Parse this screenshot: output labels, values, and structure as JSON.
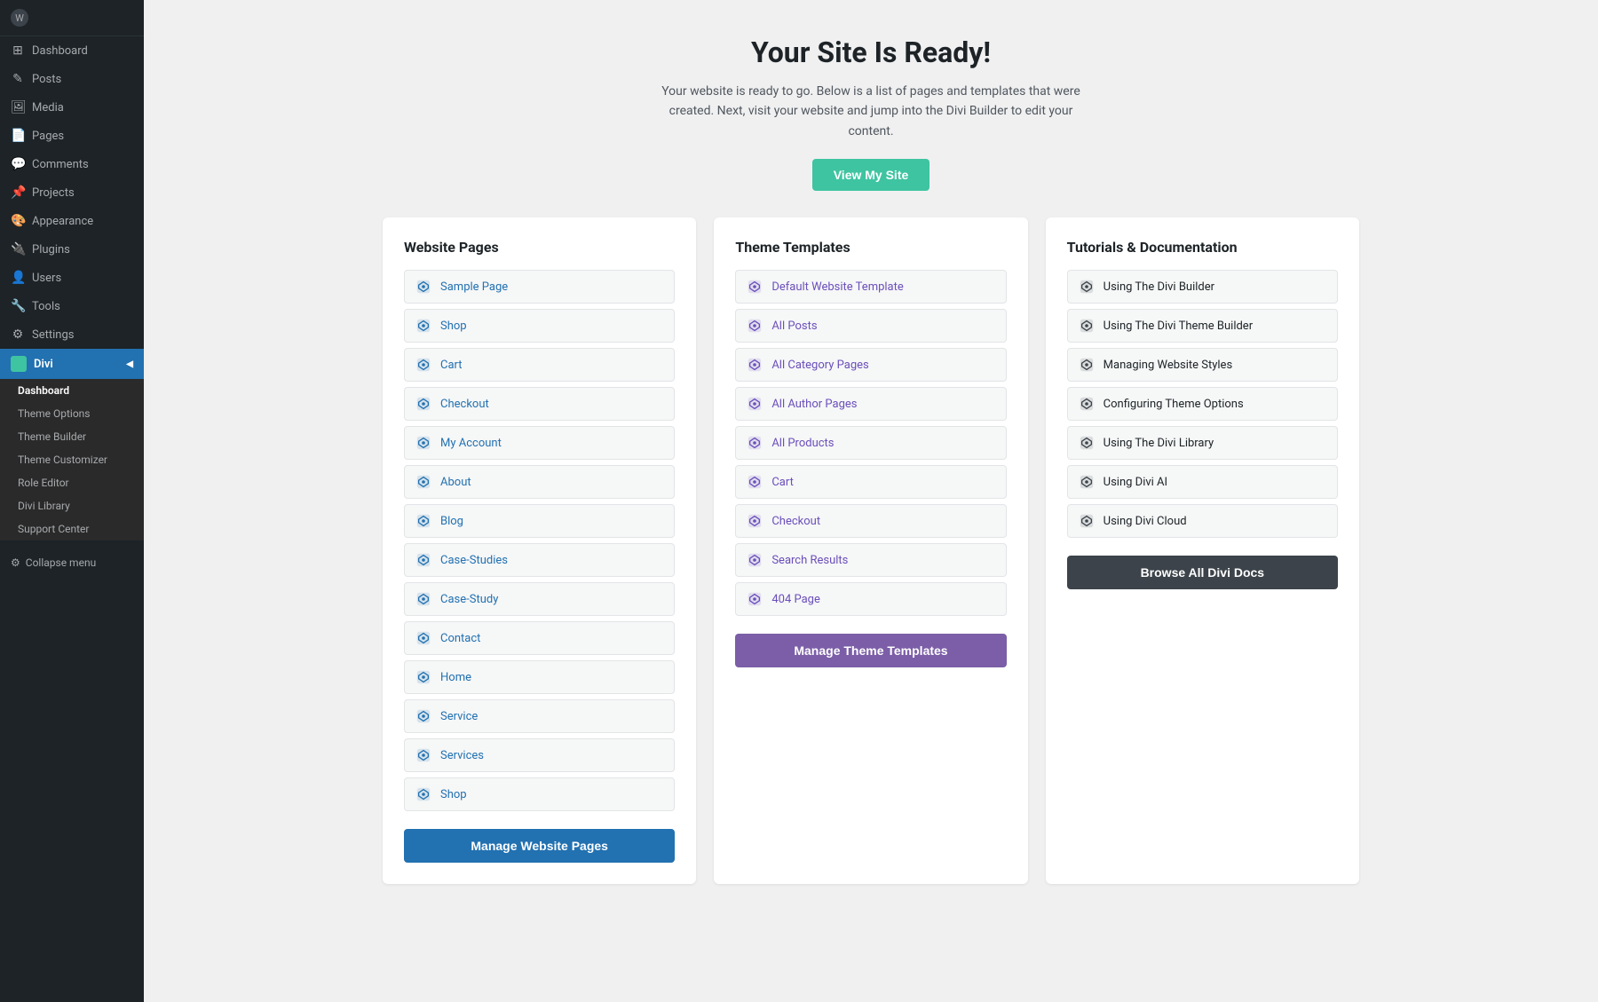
{
  "sidebar": {
    "items": [
      {
        "id": "dashboard",
        "label": "Dashboard",
        "icon": "⊞"
      },
      {
        "id": "posts",
        "label": "Posts",
        "icon": "✎"
      },
      {
        "id": "media",
        "label": "Media",
        "icon": "🖼"
      },
      {
        "id": "pages",
        "label": "Pages",
        "icon": "📄"
      },
      {
        "id": "comments",
        "label": "Comments",
        "icon": "💬"
      },
      {
        "id": "projects",
        "label": "Projects",
        "icon": "📌"
      },
      {
        "id": "appearance",
        "label": "Appearance",
        "icon": "🎨"
      },
      {
        "id": "plugins",
        "label": "Plugins",
        "icon": "🔌"
      },
      {
        "id": "users",
        "label": "Users",
        "icon": "👤"
      },
      {
        "id": "tools",
        "label": "Tools",
        "icon": "🔧"
      },
      {
        "id": "settings",
        "label": "Settings",
        "icon": "⚙"
      }
    ],
    "divi": {
      "label": "Divi",
      "subitems": [
        {
          "id": "dashboard",
          "label": "Dashboard",
          "active": true
        },
        {
          "id": "theme-options",
          "label": "Theme Options"
        },
        {
          "id": "theme-builder",
          "label": "Theme Builder"
        },
        {
          "id": "theme-customizer",
          "label": "Theme Customizer"
        },
        {
          "id": "role-editor",
          "label": "Role Editor"
        },
        {
          "id": "divi-library",
          "label": "Divi Library"
        },
        {
          "id": "support-center",
          "label": "Support Center"
        }
      ]
    },
    "collapse_label": "Collapse menu"
  },
  "main": {
    "title": "Your Site Is Ready!",
    "subtitle": "Your website is ready to go. Below is a list of pages and templates that were created. Next, visit your website and jump into the Divi Builder to edit your content.",
    "view_site_btn": "View My Site",
    "columns": {
      "website_pages": {
        "heading": "Website Pages",
        "items": [
          "Sample Page",
          "Shop",
          "Cart",
          "Checkout",
          "My Account",
          "About",
          "Blog",
          "Case-Studies",
          "Case-Study",
          "Contact",
          "Home",
          "Service",
          "Services",
          "Shop"
        ],
        "manage_btn": "Manage Website Pages"
      },
      "theme_templates": {
        "heading": "Theme Templates",
        "items": [
          "Default Website Template",
          "All Posts",
          "All Category Pages",
          "All Author Pages",
          "All Products",
          "Cart",
          "Checkout",
          "Search Results",
          "404 Page"
        ],
        "manage_btn": "Manage Theme Templates"
      },
      "tutorials": {
        "heading": "Tutorials & Documentation",
        "items": [
          "Using The Divi Builder",
          "Using The Divi Theme Builder",
          "Managing Website Styles",
          "Configuring Theme Options",
          "Using The Divi Library",
          "Using Divi AI",
          "Using Divi Cloud"
        ],
        "manage_btn": "Browse All Divi Docs"
      }
    }
  }
}
